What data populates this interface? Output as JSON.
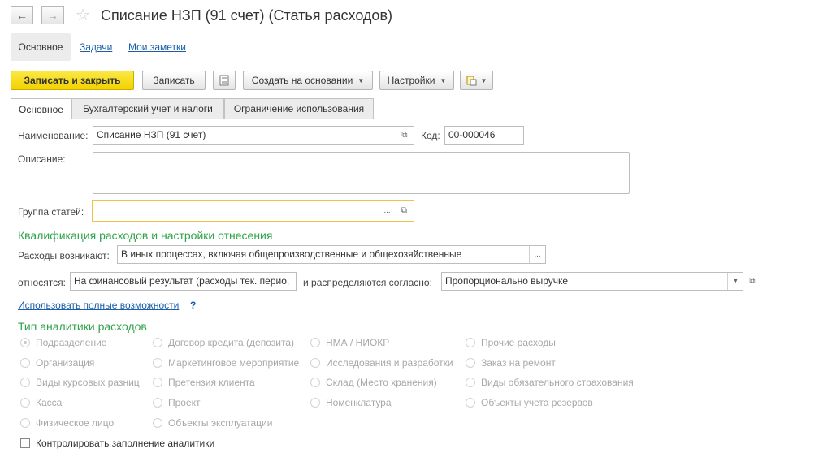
{
  "header": {
    "back_icon": "arrow-left-icon",
    "forward_icon": "arrow-right-icon",
    "favorite_icon": "star-icon",
    "title": "Списание НЗП (91 счет) (Статья расходов)"
  },
  "top_tabs": {
    "main": "Основное",
    "tasks": "Задачи",
    "notes": "Мои заметки"
  },
  "toolbar": {
    "save_close": "Записать и закрыть",
    "save": "Записать",
    "report_icon": "report-icon",
    "create_based": "Создать на основании",
    "settings": "Настройки",
    "attach_icon": "document-attach-icon"
  },
  "tabs": [
    "Основное",
    "Бухгалтерский учет и налоги",
    "Ограничение использования"
  ],
  "form": {
    "name_label": "Наименование:",
    "name_value": "Списание НЗП (91 счет)",
    "code_label": "Код:",
    "code_value": "00-000046",
    "description_label": "Описание:",
    "description_value": "",
    "group_label": "Группа статей:",
    "group_value": "",
    "choose_label": "..."
  },
  "qualification": {
    "title": "Квалификация расходов и настройки отнесения",
    "arise_label": "Расходы возникают:",
    "arise_value": "В иных процессах, включая общепроизводственные и общехозяйственные",
    "relate_label": "относятся:",
    "relate_value": "На финансовый результат (расходы тек. перио,",
    "distribute_label": "и распределяются согласно:",
    "distribute_value": "Пропорционально выручке",
    "full_link": "Использовать полные возможности",
    "help": "?"
  },
  "analytics": {
    "title": "Тип аналитики расходов",
    "columns": [
      [
        "Подразделение",
        "Организация",
        "Виды курсовых разниц",
        "Касса",
        "Физическое лицо"
      ],
      [
        "Договор кредита (депозита)",
        "Маркетинговое мероприятие",
        "Претензия клиента",
        "Проект",
        "Объекты эксплуатации"
      ],
      [
        "НМА / НИОКР",
        "Исследования и разработки",
        "Склад (Место хранения)",
        "Номенклатура"
      ],
      [
        "Прочие расходы",
        "Заказ на ремонт",
        "Виды обязательного страхования",
        "Объекты учета резервов"
      ]
    ],
    "selected": "Подразделение",
    "control_label": "Контролировать заполнение аналитики",
    "control_checked": false
  }
}
